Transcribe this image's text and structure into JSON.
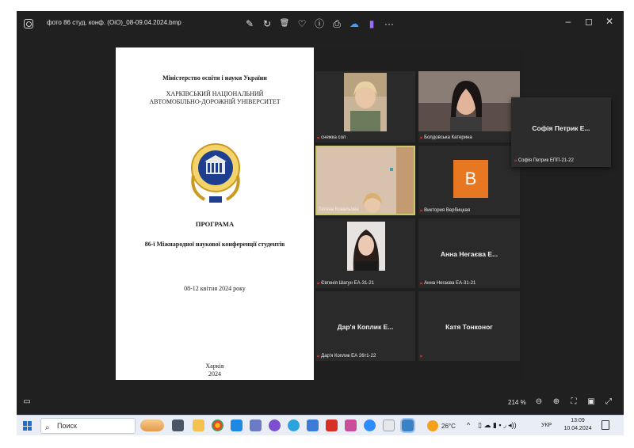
{
  "window": {
    "file_title": "фото 86 студ. конф. (ОіО)_08-09.04.2024.bmp",
    "minimize_glyph": "–",
    "maximize_glyph": "◻",
    "close_glyph": "✕"
  },
  "toolbar": {
    "icons": [
      "edit-icon",
      "rotate-icon",
      "delete-icon",
      "favorite-icon",
      "info-icon",
      "print-icon",
      "onedrive-icon",
      "clipchamp-icon",
      "more-icon"
    ],
    "glyphs": [
      "✎",
      "↻",
      "🗑",
      "♡",
      "ⓘ",
      "⎙",
      "☁",
      "▮",
      "···"
    ]
  },
  "document": {
    "ministry": "Міністерство освіти і науки України",
    "university_line1": "ХАРКІВСЬКИЙ НАЦІОНАЛЬНИЙ",
    "university_line2": "АВТОМОБІЛЬНО-ДОРОЖНІЙ УНІВЕРСИТЕТ",
    "program": "ПРОГРАМА",
    "conference": "86-ї Міжнародної наукової конференції студентів",
    "dates": "08-12 квітня 2024 року",
    "city": "Харків",
    "year": "2024"
  },
  "participants": [
    {
      "name": "снежка сол",
      "has_video": true
    },
    {
      "name": "Болдовська Катерина",
      "has_video": true
    },
    {
      "name": "Тетяна Ковальова",
      "has_video": true
    },
    {
      "name": "Виктория Вербицкая",
      "avatar_letter": "B"
    },
    {
      "name": "Євгенія Шагун ЕА-31-21",
      "has_video": true
    },
    {
      "name": "Анна Негаєва ЕА-31-21",
      "display": "Анна Негаєва Е..."
    },
    {
      "name": "Дар'я Коплик ЕА 26т1-22",
      "display": "Дар'я Коплик Е..."
    },
    {
      "name": "",
      "display": "Катя Тонконог"
    }
  ],
  "floating_participant": {
    "display": "Софія Петрик Е...",
    "name": "Софія Петрик ЕПП-21-22"
  },
  "statusbar": {
    "zoom": "214 %"
  },
  "taskbar": {
    "search_placeholder": "Поиск",
    "weather": "26°C",
    "language": "УКР",
    "time": "13:09",
    "date": "10.04.2024"
  },
  "colors": {
    "viewer_bg": "#202020",
    "mic_muted": "#e03a2e",
    "avatar_orange": "#e87722",
    "active_speaker_border": "#c9c96a"
  }
}
